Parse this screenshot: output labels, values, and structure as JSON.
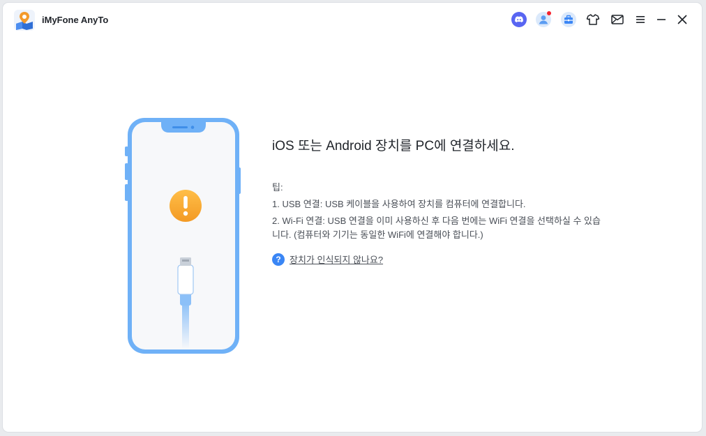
{
  "app": {
    "title": "iMyFone AnyTo",
    "logo_icon": "map-pin-logo-icon"
  },
  "toolbar": {
    "buttons": [
      {
        "name": "discord-icon"
      },
      {
        "name": "account-icon",
        "badge": true
      },
      {
        "name": "toolbox-icon"
      },
      {
        "name": "skin-shirt-icon"
      },
      {
        "name": "feedback-mail-icon"
      },
      {
        "name": "menu-icon"
      },
      {
        "name": "minimize-icon"
      },
      {
        "name": "close-icon"
      }
    ]
  },
  "main": {
    "headline": "iOS 또는 Android 장치를 PC에 연결하세요.",
    "tips_title": "팁:",
    "tips": [
      "1. USB 연결: USB 케이블을 사용하여 장치를 컴퓨터에 연결합니다.",
      "2. Wi-Fi 연결: USB 연결을 이미 사용하신 후 다음 번에는 WiFi 연결을 선택하실 수 있습니다. (컴퓨터와 기기는 동일한 WiFi에 연결해야 합니다.)"
    ],
    "help_link": "장치가 인식되지 않나요?",
    "help_icon_glyph": "?"
  },
  "colors": {
    "accent": "#3a86f5",
    "phone_frame": "#6fb1f7",
    "warning": "#f5a623",
    "badge": "#f5222d"
  }
}
